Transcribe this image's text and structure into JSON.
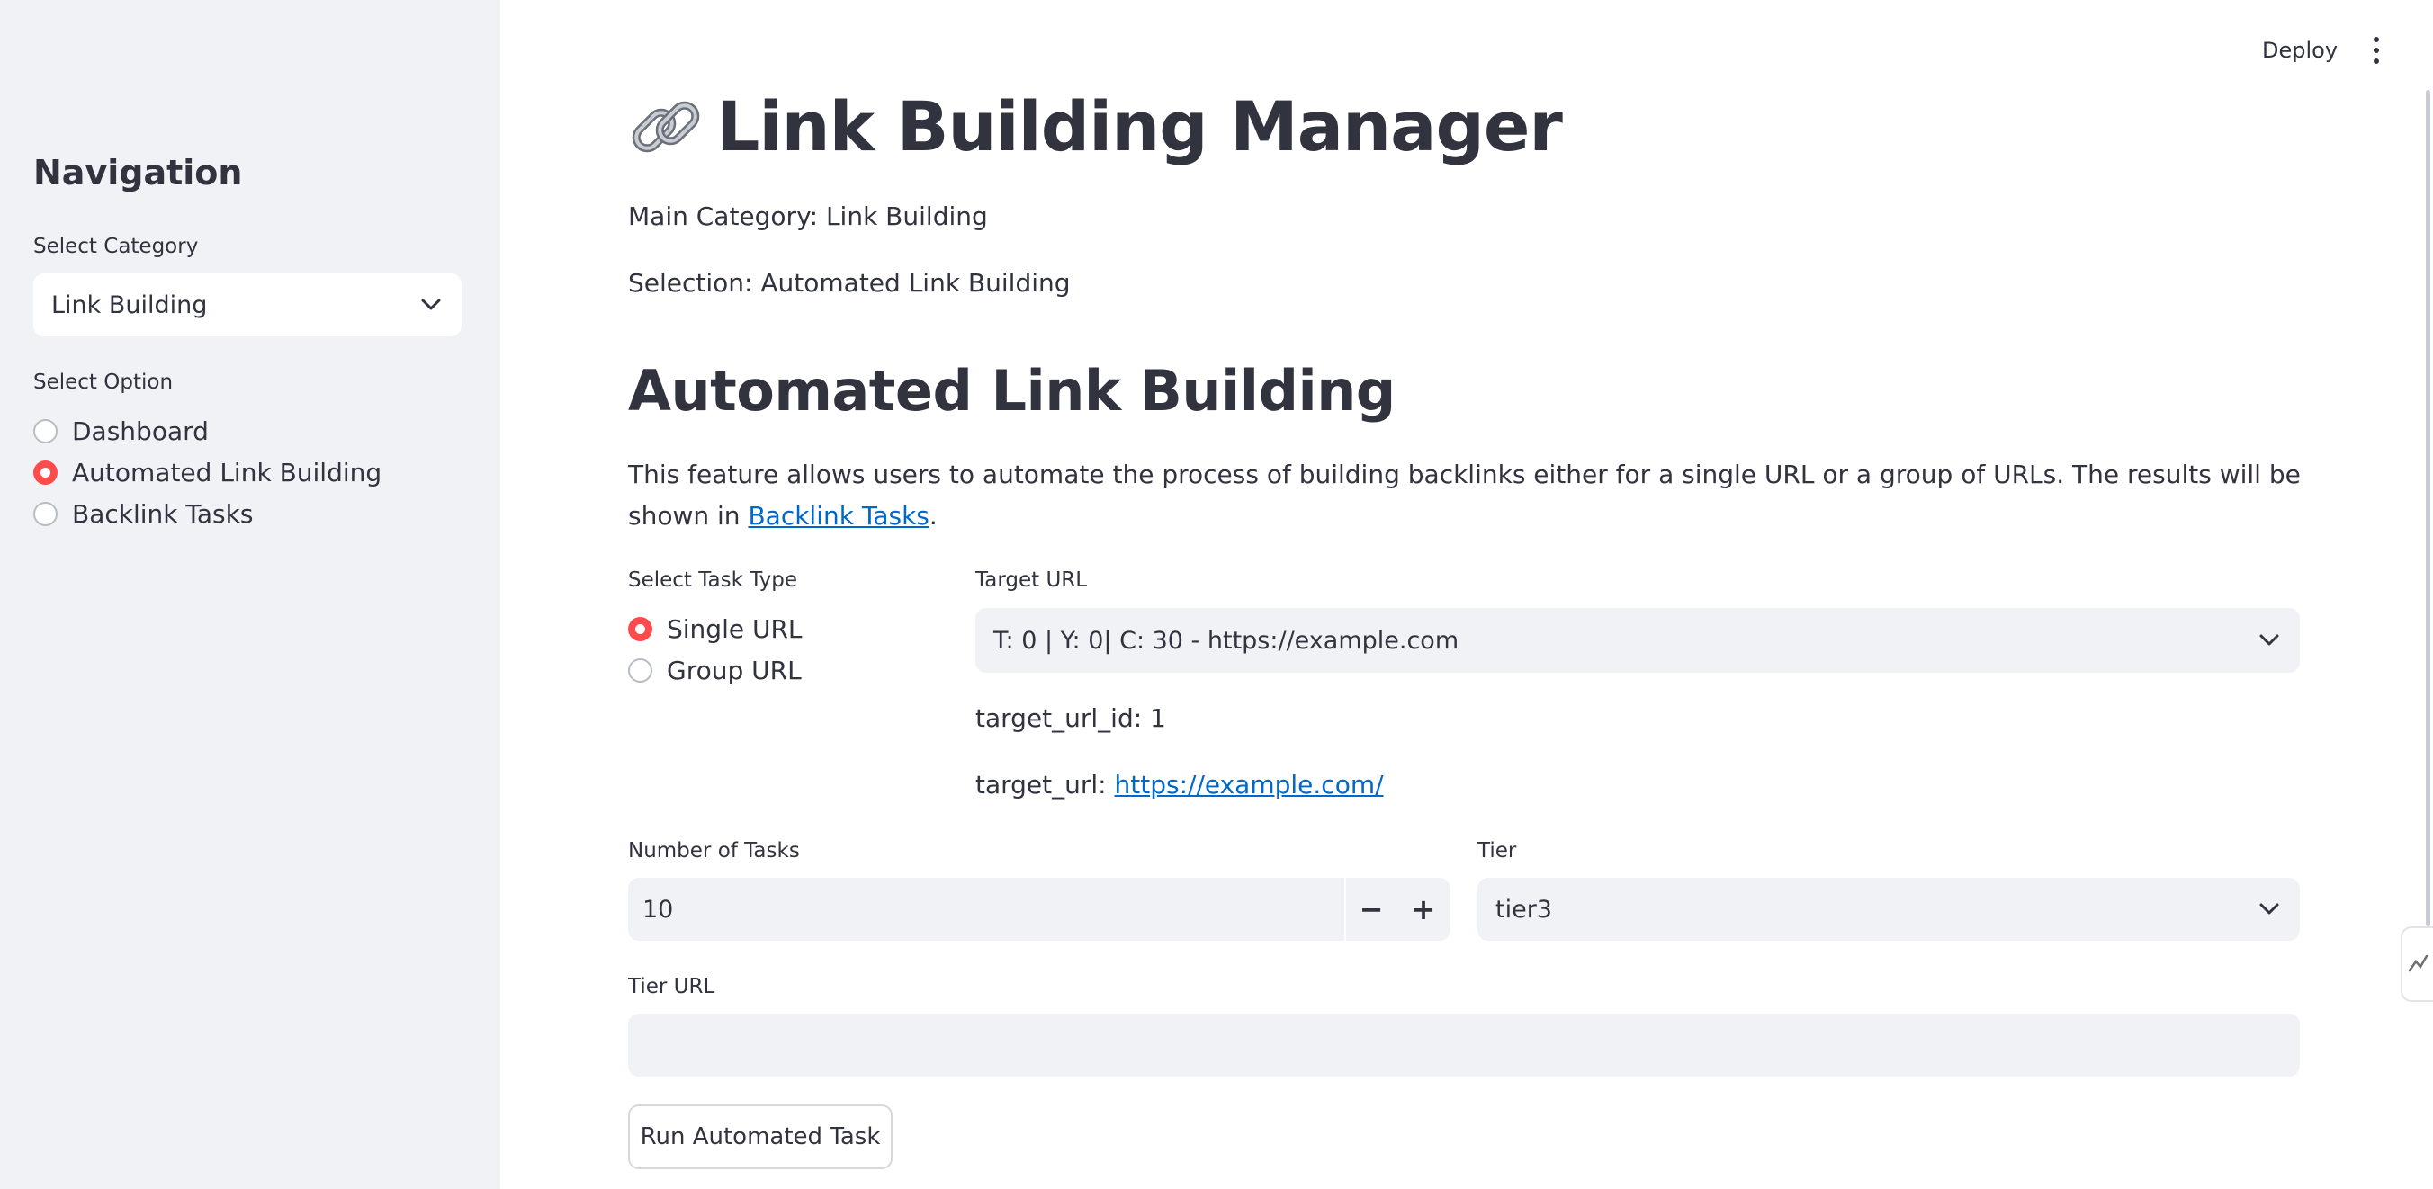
{
  "header": {
    "deploy_label": "Deploy",
    "menu_icon": "kebab-menu-icon"
  },
  "sidebar": {
    "title": "Navigation",
    "category_label": "Select Category",
    "category_value": "Link Building",
    "option_label": "Select Option",
    "options": [
      {
        "label": "Dashboard",
        "selected": false
      },
      {
        "label": "Automated Link Building",
        "selected": true
      },
      {
        "label": "Backlink Tasks",
        "selected": false
      }
    ]
  },
  "main": {
    "title_emoji": "link-icon",
    "title": "Link Building Manager",
    "main_category": "Main Category: Link Building",
    "selection": "Selection: Automated Link Building",
    "section_title": "Automated Link Building",
    "description_text": "This feature allows users to automate the process of building backlinks either for a single URL or a group of URLs. The results will be shown in",
    "description_link": "Backlink Tasks",
    "description_end": ".",
    "task_type_label": "Select Task Type",
    "task_types": [
      {
        "label": "Single URL",
        "selected": true
      },
      {
        "label": "Group URL",
        "selected": false
      }
    ],
    "target_url_label": "Target URL",
    "target_url_value": "T: 0 | Y: 0| C: 30 - https://example.com",
    "target_url_id": "target_url_id: 1",
    "target_url_prefix": "target_url:",
    "target_url_link": "https://example.com/",
    "num_tasks_label": "Number of Tasks",
    "num_tasks_value": "10",
    "minus_label": "−",
    "plus_label": "+",
    "tier_label": "Tier",
    "tier_value": "tier3",
    "tier_url_label": "Tier URL",
    "tier_url_value": "",
    "run_button": "Run Automated Task"
  },
  "colors": {
    "accent": "#ff4b4b",
    "link": "#0068c9",
    "sidebar_bg": "#f0f2f6",
    "text": "#31333f"
  }
}
